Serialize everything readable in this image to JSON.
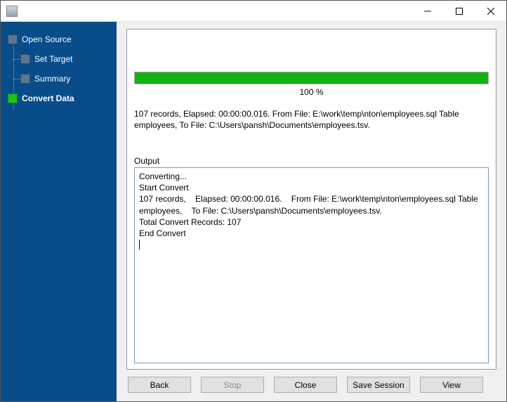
{
  "window": {
    "title": ""
  },
  "sidebar": {
    "items": [
      {
        "label": "Open Source",
        "active": false,
        "child": false
      },
      {
        "label": "Set Target",
        "active": false,
        "child": true
      },
      {
        "label": "Summary",
        "active": false,
        "child": true
      },
      {
        "label": "Convert Data",
        "active": true,
        "child": false
      }
    ]
  },
  "progress": {
    "percent_text": "100 %",
    "fill_percent": 100,
    "bar_color": "#13b313"
  },
  "status": {
    "text": "107 records,    Elapsed: 00:00:00.016.    From File: E:\\work\\temp\\nton\\employees.sql Table employees,    To File: C:\\Users\\pansh\\Documents\\employees.tsv."
  },
  "output": {
    "label": "Output",
    "lines": [
      "Converting...",
      "Start Convert",
      "107 records,    Elapsed: 00:00:00.016.    From File: E:\\work\\temp\\nton\\employees.sql Table employees,    To File: C:\\Users\\pansh\\Documents\\employees.tsv.",
      "Total Convert Records: 107",
      "End Convert"
    ]
  },
  "buttons": {
    "back": "Back",
    "stop": "Stop",
    "close": "Close",
    "save_session": "Save Session",
    "view": "View",
    "stop_enabled": false
  }
}
